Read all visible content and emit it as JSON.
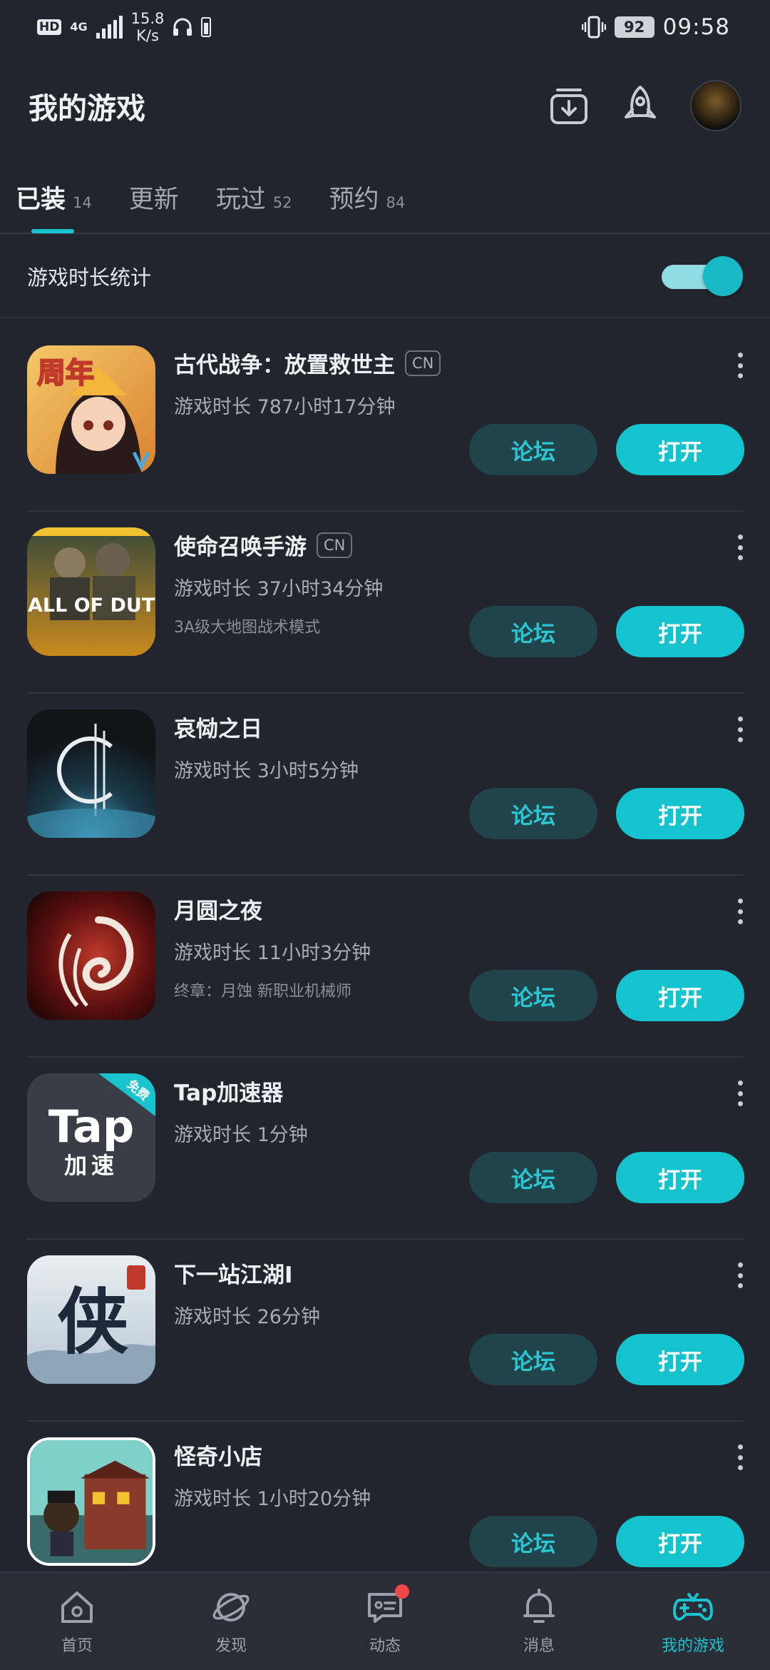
{
  "status_bar": {
    "hd": "HD",
    "network": "4G",
    "speed_value": "15.8",
    "speed_unit": "K/s",
    "battery": "92",
    "time": "09:58"
  },
  "header": {
    "title": "我的游戏"
  },
  "tabs": [
    {
      "label": "已装",
      "count": "14"
    },
    {
      "label": "更新",
      "count": ""
    },
    {
      "label": "玩过",
      "count": "52"
    },
    {
      "label": "预约",
      "count": "84"
    }
  ],
  "stat_toggle": {
    "label": "游戏时长统计",
    "on": true
  },
  "buttons": {
    "forum": "论坛",
    "open": "打开"
  },
  "games": [
    {
      "name": "古代战争：放置救世主",
      "badge": "CN",
      "playtime": "游戏时长 787小时17分钟",
      "desc": "",
      "icon_text": "周年"
    },
    {
      "name": "使命召唤手游",
      "badge": "CN",
      "playtime": "游戏时长 37小时34分钟",
      "desc": "3A级大地图战术模式",
      "icon_text": "CALL OF DUTY"
    },
    {
      "name": "哀恸之日",
      "badge": "",
      "playtime": "游戏时长 3小时5分钟",
      "desc": "",
      "icon_text": ""
    },
    {
      "name": "月圆之夜",
      "badge": "",
      "playtime": "游戏时长 11小时3分钟",
      "desc": "终章：月蚀 新职业机械师",
      "icon_text": ""
    },
    {
      "name": "Tap加速器",
      "badge": "",
      "playtime": "游戏时长 1分钟",
      "desc": "",
      "icon_text": "Tap",
      "icon_sub": "加速",
      "icon_ribbon": "免费"
    },
    {
      "name": "下一站江湖Ⅰ",
      "badge": "",
      "playtime": "游戏时长 26分钟",
      "desc": "",
      "icon_text": "侠"
    },
    {
      "name": "怪奇小店",
      "badge": "",
      "playtime": "游戏时长 1小时20分钟",
      "desc": "",
      "icon_text": ""
    }
  ],
  "bottom_nav": [
    {
      "label": "首页",
      "icon": "home-icon"
    },
    {
      "label": "发现",
      "icon": "discover-icon"
    },
    {
      "label": "动态",
      "icon": "feed-icon"
    },
    {
      "label": "消息",
      "icon": "bell-icon"
    },
    {
      "label": "我的游戏",
      "icon": "gamepad-icon"
    }
  ],
  "colors": {
    "background": "#22252e",
    "accent": "#15c3ce",
    "forum_button_bg": "#21434a",
    "badge_red": "#f0484a"
  }
}
